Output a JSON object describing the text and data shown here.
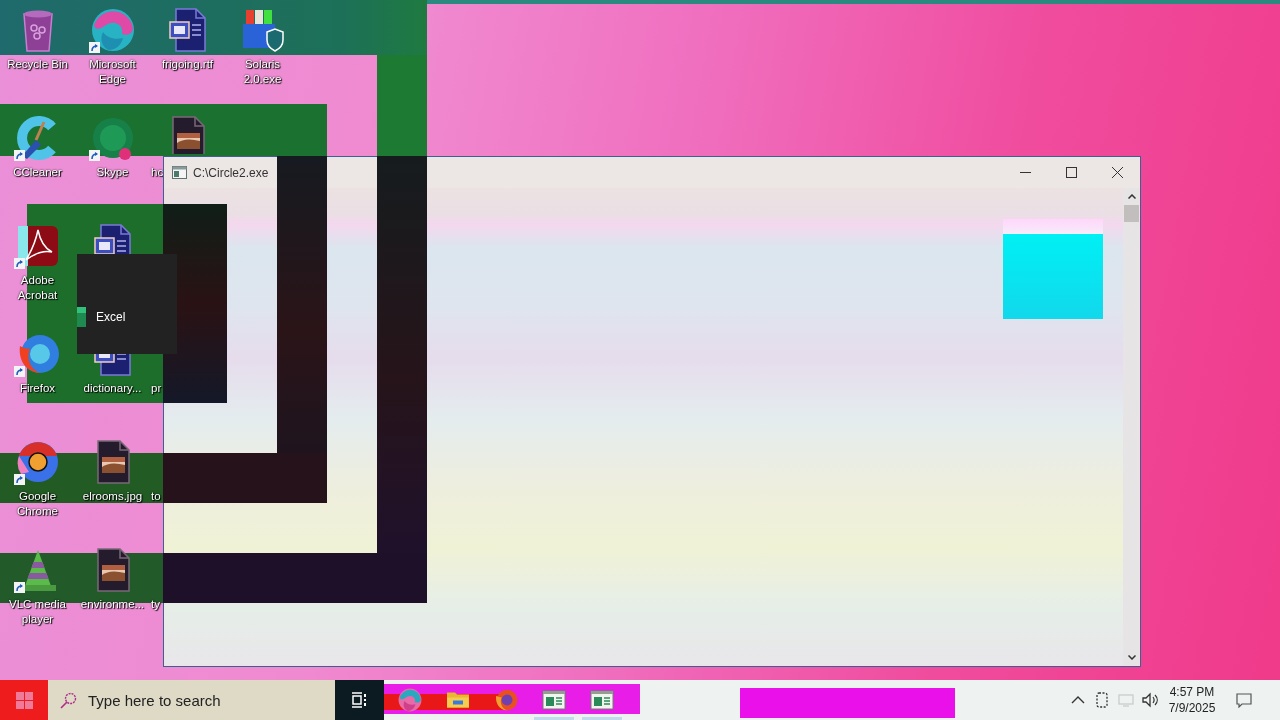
{
  "desktop": {
    "rows": [
      [
        {
          "label": "Recycle Bin",
          "kind": "recycle",
          "shortcut": false
        },
        {
          "label": "Microsoft Edge",
          "kind": "swirl",
          "shortcut": true
        },
        {
          "label": "frigoing.rtf",
          "kind": "document",
          "shortcut": false
        },
        {
          "label": "Solaris 2.0.exe",
          "kind": "installer",
          "shortcut": false
        }
      ],
      [
        {
          "label": "CCleaner",
          "kind": "arc",
          "shortcut": true
        },
        {
          "label": "Skype",
          "kind": "circle",
          "shortcut": true
        },
        {
          "label": "hc",
          "kind": "image",
          "shortcut": false
        }
      ],
      [
        {
          "label": "Adobe Acrobat",
          "kind": "pdf",
          "shortcut": true
        },
        {
          "kind": "document",
          "shortcut": false
        }
      ],
      [
        {
          "label": "Firefox",
          "kind": "globe",
          "shortcut": true
        },
        {
          "label": "dictionary...",
          "kind": "document",
          "shortcut": false
        },
        {
          "label": "pr"
        }
      ],
      [
        {
          "label": "Google Chrome",
          "kind": "ring",
          "shortcut": true
        },
        {
          "label": "elrooms.jpg",
          "kind": "image",
          "shortcut": false
        },
        {
          "label": "to"
        }
      ],
      [
        {
          "label": "VLC media player",
          "kind": "cone",
          "shortcut": true
        },
        {
          "label": "environme...",
          "kind": "image",
          "shortcut": false
        },
        {
          "label": "ty"
        }
      ]
    ]
  },
  "window": {
    "title": "C:\\Circle2.exe"
  },
  "thumbnail": {
    "label": "Excel"
  },
  "taskbar": {
    "search": {
      "placeholder": "Type here to search"
    },
    "apps": [
      {
        "kind": "swirl",
        "open": false
      },
      {
        "kind": "folder",
        "open": false
      },
      {
        "kind": "globe",
        "open": false
      },
      {
        "kind": "window",
        "open": true
      },
      {
        "kind": "window",
        "open": true
      }
    ],
    "clock": {
      "time": "4:57 PM",
      "date": "7/9/2025"
    }
  }
}
